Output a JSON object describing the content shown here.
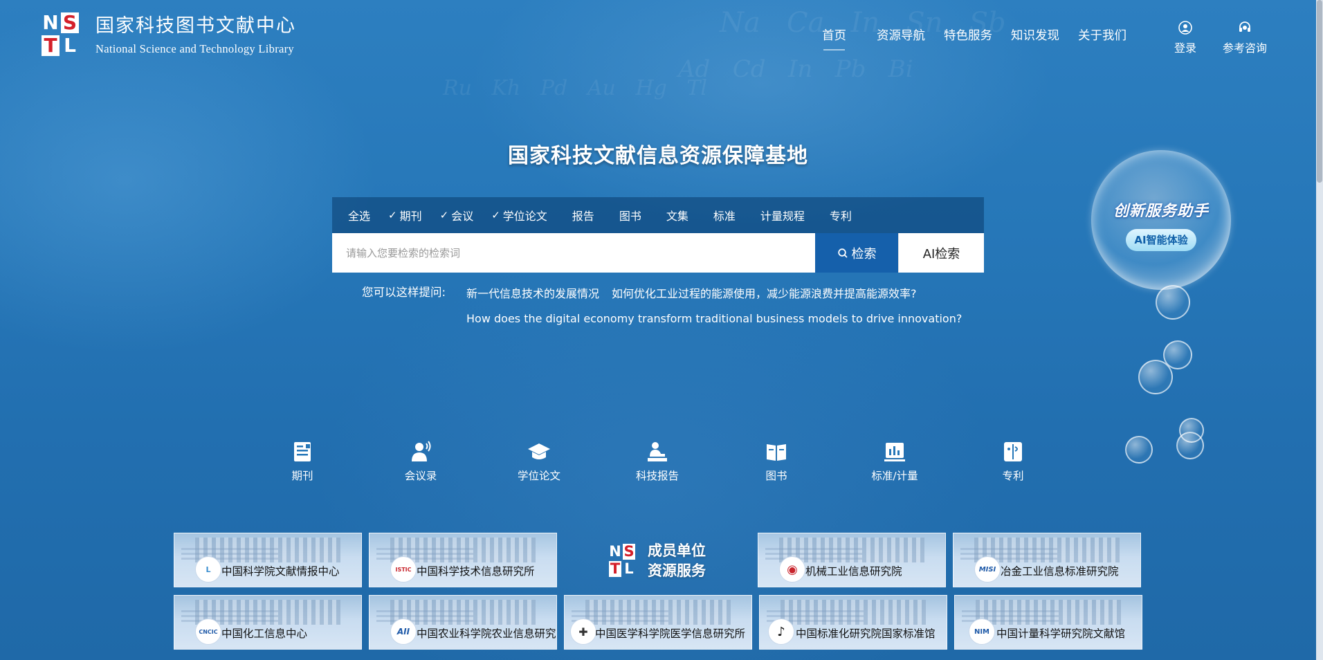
{
  "brand": {
    "mark": [
      "N",
      "S",
      "T",
      "L"
    ],
    "name_cn": "国家科技图书文献中心",
    "name_en": "National Science and Technology Library"
  },
  "nav": {
    "items": [
      "首页",
      "资源导航",
      "特色服务",
      "知识发现",
      "关于我们"
    ],
    "active": "首页",
    "login": "登录",
    "consult": "参考咨询"
  },
  "hero": {
    "title": "国家科技文献信息资源保障基地"
  },
  "search": {
    "categories": [
      {
        "label": "全选",
        "checked": false
      },
      {
        "label": "期刊",
        "checked": true
      },
      {
        "label": "会议",
        "checked": true
      },
      {
        "label": "学位论文",
        "checked": true
      },
      {
        "label": "报告",
        "checked": false
      },
      {
        "label": "图书",
        "checked": false
      },
      {
        "label": "文集",
        "checked": false
      },
      {
        "label": "标准",
        "checked": false
      },
      {
        "label": "计量规程",
        "checked": false
      },
      {
        "label": "专利",
        "checked": false
      }
    ],
    "placeholder": "请输入您要检索的检索词",
    "search_button": "检索",
    "ai_button": "AI检索"
  },
  "suggestions": {
    "label": "您可以这样提问:",
    "items": [
      "新一代信息技术的发展情况",
      "如何优化工业过程的能源使用，减少能源浪费并提高能源效率?",
      "How does the digital economy transform traditional business models to drive innovation?"
    ]
  },
  "assistant": {
    "title": "创新服务助手",
    "button": "AI智能体验"
  },
  "resources": [
    {
      "label": "期刊",
      "icon": "journal-icon"
    },
    {
      "label": "会议录",
      "icon": "conference-icon"
    },
    {
      "label": "学位论文",
      "icon": "graduation-cap-icon"
    },
    {
      "label": "科技报告",
      "icon": "report-icon"
    },
    {
      "label": "图书",
      "icon": "book-icon"
    },
    {
      "label": "标准/计量",
      "icon": "standard-chart-icon"
    },
    {
      "label": "专利",
      "icon": "patent-icon"
    }
  ],
  "members": {
    "title_line1": "成员单位",
    "title_line2": "资源服务",
    "items": [
      {
        "name": "中国科学院文献情报中心",
        "logo": "L"
      },
      {
        "name": "中国科学技术信息研究所",
        "logo": "ISTIC"
      },
      {
        "name": "机械工业信息研究院",
        "logo": "◉"
      },
      {
        "name": "冶金工业信息标准研究院",
        "logo": "MISI"
      },
      {
        "name": "中国化工信息中心",
        "logo": "CNCIC"
      },
      {
        "name": "中国农业科学院农业信息研究所",
        "logo": "AII"
      },
      {
        "name": "中国医学科学院医学信息研究所",
        "logo": "✚"
      },
      {
        "name": "中国标准化研究院国家标准馆",
        "logo": "♪"
      },
      {
        "name": "中国计量科学研究院文献馆",
        "logo": "NIM"
      }
    ]
  },
  "colors": {
    "background": "#2677b8",
    "search_button": "#1560ab",
    "logo_red": "#d4202a"
  }
}
